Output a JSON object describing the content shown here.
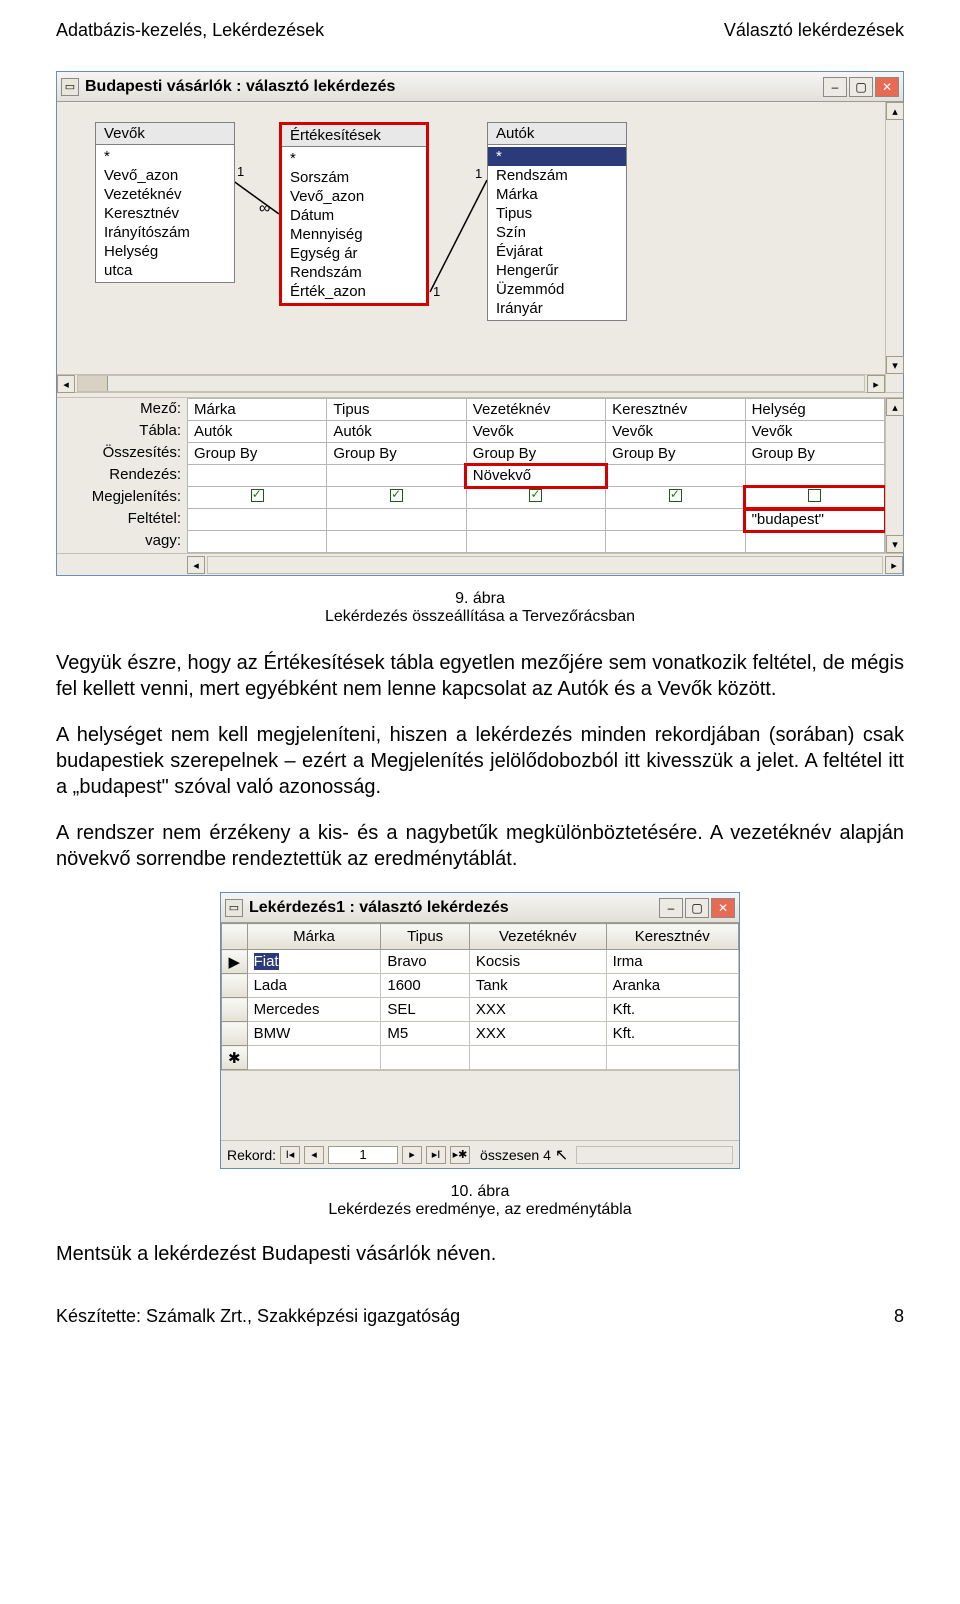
{
  "header": {
    "left": "Adatbázis-kezelés, Lekérdezések",
    "right": "Választó lekérdezések"
  },
  "win1": {
    "title": "Budapesti vásárlók : választó lekérdezés",
    "tables": {
      "vevok": {
        "name": "Vevők",
        "fields": [
          "*",
          "Vevő_azon",
          "Vezetéknév",
          "Keresztnév",
          "Irányítószám",
          "Helység",
          "utca"
        ]
      },
      "ertek": {
        "name": "Értékesítések",
        "fields": [
          "*",
          "Sorszám",
          "Vevő_azon",
          "Dátum",
          "Mennyiség",
          "Egység ár",
          "Rendszám",
          "Érték_azon"
        ]
      },
      "autok": {
        "name": "Autók",
        "fields": [
          "*",
          "Rendszám",
          "Márka",
          "Tipus",
          "Szín",
          "Évjárat",
          "Hengerűr",
          "Üzemmód",
          "Irányár"
        ]
      }
    },
    "row_labels": [
      "Mező:",
      "Tábla:",
      "Összesítés:",
      "Rendezés:",
      "Megjelenítés:",
      "Feltétel:",
      "vagy:"
    ],
    "grid": {
      "cols": [
        {
          "mezo": "Márka",
          "tabla": "Autók",
          "ossz": "Group By",
          "rend": "",
          "show": true,
          "felt": ""
        },
        {
          "mezo": "Tipus",
          "tabla": "Autók",
          "ossz": "Group By",
          "rend": "",
          "show": true,
          "felt": ""
        },
        {
          "mezo": "Vezetéknév",
          "tabla": "Vevők",
          "ossz": "Group By",
          "rend": "Növekvő",
          "show": true,
          "felt": ""
        },
        {
          "mezo": "Keresztnév",
          "tabla": "Vevők",
          "ossz": "Group By",
          "rend": "",
          "show": true,
          "felt": ""
        },
        {
          "mezo": "Helység",
          "tabla": "Vevők",
          "ossz": "Group By",
          "rend": "",
          "show": false,
          "felt": "\"budapest\""
        }
      ]
    }
  },
  "caption1_a": "9. ábra",
  "caption1_b": "Lekérdezés összeállítása a Tervezőrácsban",
  "para1": "Vegyük észre, hogy az Értékesítések tábla egyetlen mezőjére sem vonatkozik feltétel, de mégis fel kellett venni, mert egyébként nem lenne kapcsolat az Autók és a Vevők között.",
  "para2": "A helységet nem kell megjeleníteni, hiszen a lekérdezés minden rekordjában (sorában) csak budapestiek szerepelnek – ezért a Megjelenítés jelölődobozból itt kivesszük a jelet. A feltétel itt a „budapest\" szóval való azonosság.",
  "para3": "A rendszer nem érzékeny a kis- és a nagybetűk megkülönböztetésére. A vezetéknév alapján növekvő sorrendbe rendeztettük az eredménytáblát.",
  "win2": {
    "title": "Lekérdezés1 : választó lekérdezés",
    "columns": [
      "Márka",
      "Tipus",
      "Vezetéknév",
      "Keresztnév"
    ],
    "rows": [
      [
        "Fiat",
        "Bravo",
        "Kocsis",
        "Irma"
      ],
      [
        "Lada",
        "1600",
        "Tank",
        "Aranka"
      ],
      [
        "Mercedes",
        "SEL",
        "XXX",
        "Kft."
      ],
      [
        "BMW",
        "M5",
        "XXX",
        "Kft."
      ]
    ],
    "record_label": "Rekord:",
    "record_value": "1",
    "record_total_label": "összesen 4"
  },
  "caption2_a": "10. ábra",
  "caption2_b": "Lekérdezés eredménye, az eredménytábla",
  "save_line": "Mentsük a lekérdezést Budapesti vásárlók néven.",
  "footer": {
    "left": "Készítette: Számalk Zrt., Szakképzési igazgatóság",
    "right": "8"
  },
  "join_labels": {
    "one_a": "1",
    "inf": "∞",
    "one_b": "1",
    "one_c": "1"
  }
}
